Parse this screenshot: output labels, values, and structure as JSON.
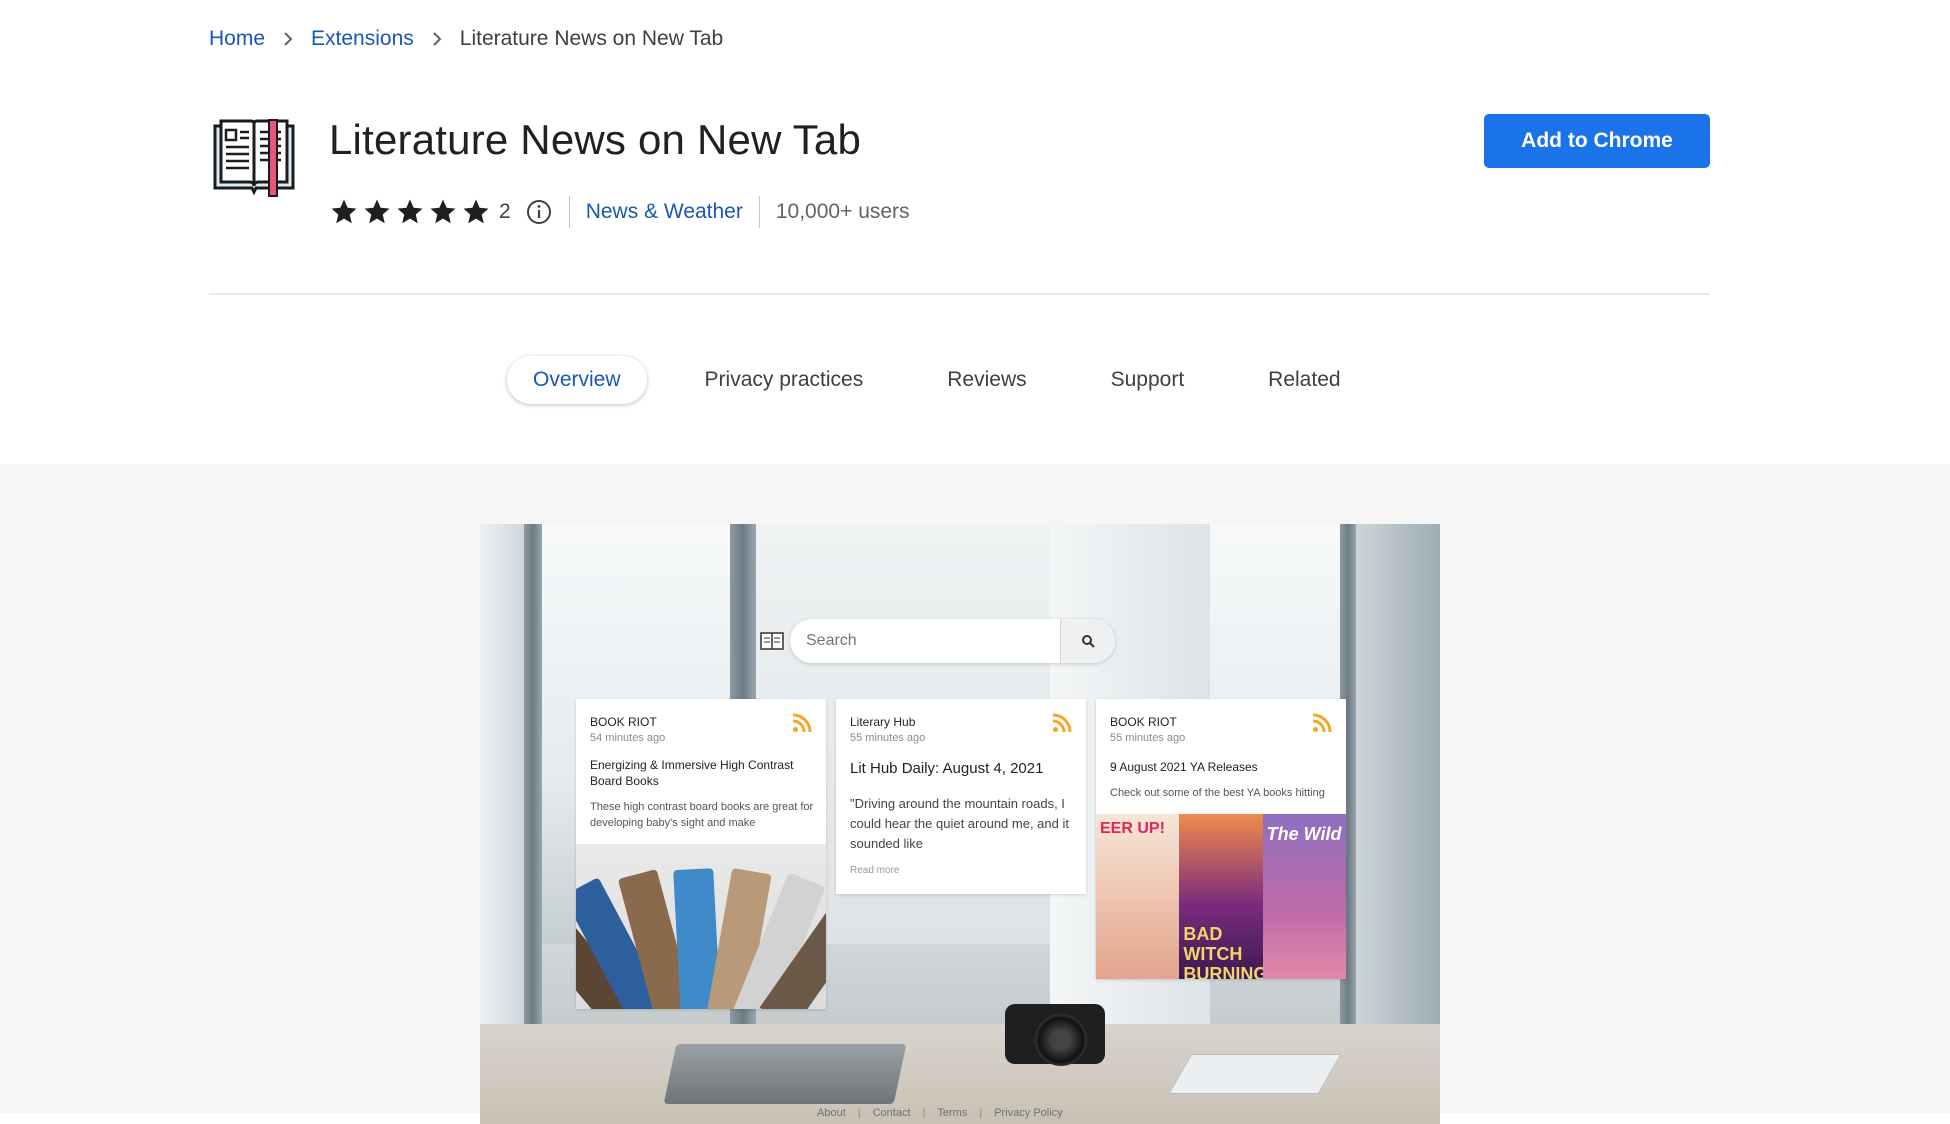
{
  "breadcrumb": {
    "items": [
      {
        "label": "Home"
      },
      {
        "label": "Extensions"
      },
      {
        "label": "Literature News on New Tab"
      }
    ]
  },
  "extension": {
    "title": "Literature News on New Tab",
    "rating": {
      "stars": 5,
      "count": "2"
    },
    "category": "News & Weather",
    "users": "10,000+ users",
    "add_button": "Add to Chrome"
  },
  "tabs": [
    {
      "label": "Overview",
      "active": true
    },
    {
      "label": "Privacy practices",
      "active": false
    },
    {
      "label": "Reviews",
      "active": false
    },
    {
      "label": "Support",
      "active": false
    },
    {
      "label": "Related",
      "active": false
    }
  ],
  "screenshot": {
    "search_placeholder": "Search",
    "cards": [
      {
        "source": "BOOK RIOT",
        "time": "54 minutes ago",
        "headline": "Energizing & Immersive High Contrast Board Books",
        "body": "These high contrast board books are great for developing baby's sight and make"
      },
      {
        "source": "Literary Hub",
        "time": "55 minutes ago",
        "headline": "Lit Hub Daily: August 4, 2021",
        "body": "\"Driving around the mountain roads, I could hear the quiet around me, and it sounded like",
        "read_more": "Read more"
      },
      {
        "source": "BOOK RIOT",
        "time": "55 minutes ago",
        "headline": "9 August 2021 YA Releases",
        "body": "Check out some of the best YA books hitting"
      }
    ],
    "covers": [
      "EER UP!",
      "BAD WITCH BURNING",
      "The Wild"
    ],
    "footer_links": [
      "About",
      "Contact",
      "Terms",
      "Privacy Policy"
    ]
  },
  "colors": {
    "accent": "#1a73e8",
    "link": "#1a57b6",
    "rss": "#f5a623"
  }
}
